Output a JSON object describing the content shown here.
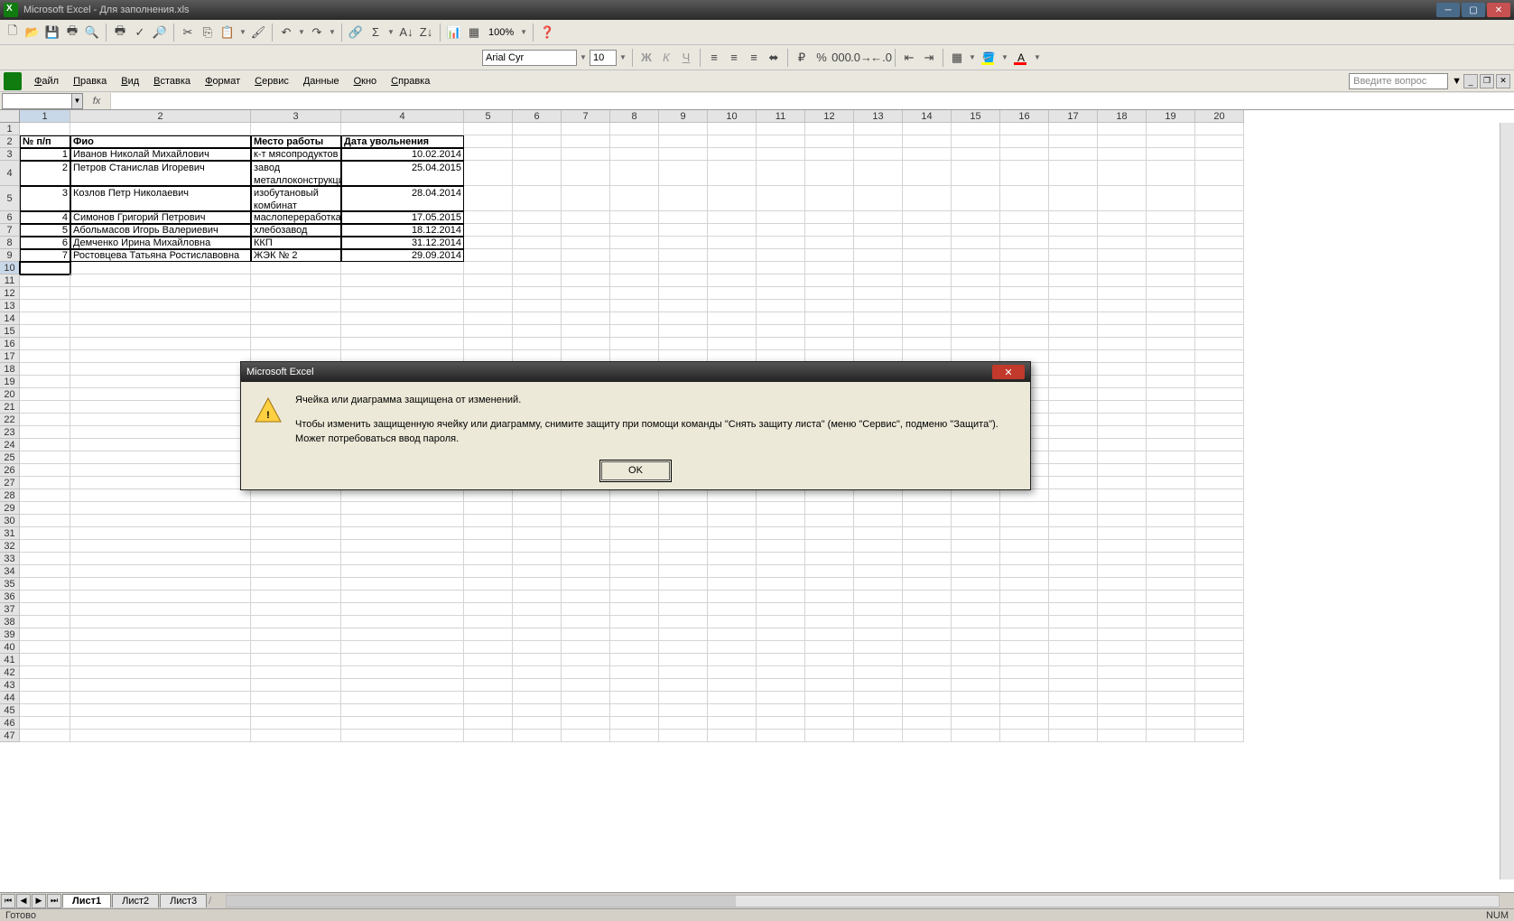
{
  "titlebar": {
    "title": "Microsoft Excel - Для заполнения.xls"
  },
  "menus": [
    "Файл",
    "Правка",
    "Вид",
    "Вставка",
    "Формат",
    "Сервис",
    "Данные",
    "Окно",
    "Справка"
  ],
  "question_box": "Введите вопрос",
  "toolbar": {
    "zoom": "100%",
    "font_name": "Arial Cyr",
    "font_size": "10"
  },
  "namebox": "",
  "columns_visible": 20,
  "rows_visible": 47,
  "active_cell": {
    "row": 10,
    "col": 1
  },
  "col_widths": {
    "1": 56,
    "2": 200,
    "3": 100,
    "4": 136
  },
  "row_heights": {
    "4": 28,
    "5": 28
  },
  "data": {
    "headers_row": 2,
    "headers": {
      "1": "№ п/п",
      "2": "Фио",
      "3": "Место работы",
      "4": "Дата увольнения"
    },
    "rows": [
      {
        "r": 3,
        "1": "1",
        "2": "Иванов Николай Михайлович",
        "3": "к-т мясопродуктов",
        "4": "10.02.2014"
      },
      {
        "r": 4,
        "1": "2",
        "2": "Петров Станислав Игоревич",
        "3": "завод металлоконструкций",
        "4": "25.04.2015"
      },
      {
        "r": 5,
        "1": "3",
        "2": "Козлов Петр Николаевич",
        "3": "изобутановый комбинат",
        "4": "28.04.2014"
      },
      {
        "r": 6,
        "1": "4",
        "2": "Симонов Григорий Петрович",
        "3": "маслопереработка",
        "4": "17.05.2015"
      },
      {
        "r": 7,
        "1": "5",
        "2": "Абольмасов Игорь Валериевич",
        "3": "хлебозавод",
        "4": "18.12.2014"
      },
      {
        "r": 8,
        "1": "6",
        "2": "Демченко Ирина Михайловна",
        "3": "ККП",
        "4": "31.12.2014"
      },
      {
        "r": 9,
        "1": "7",
        "2": "Ростовцева Татьяна Ростиславовна",
        "3": "ЖЭК № 2",
        "4": "29.09.2014"
      }
    ]
  },
  "sheets": [
    "Лист1",
    "Лист2",
    "Лист3"
  ],
  "active_sheet": 0,
  "status": {
    "ready": "Готово",
    "num": "NUM"
  },
  "dialog": {
    "title": "Microsoft Excel",
    "line1": "Ячейка или диаграмма защищена от изменений.",
    "line2": "Чтобы изменить защищенную ячейку или диаграмму, снимите защиту при помощи команды \"Снять защиту листа\" (меню \"Сервис\", подменю \"Защита\"). Может потребоваться ввод пароля.",
    "ok": "OK"
  }
}
